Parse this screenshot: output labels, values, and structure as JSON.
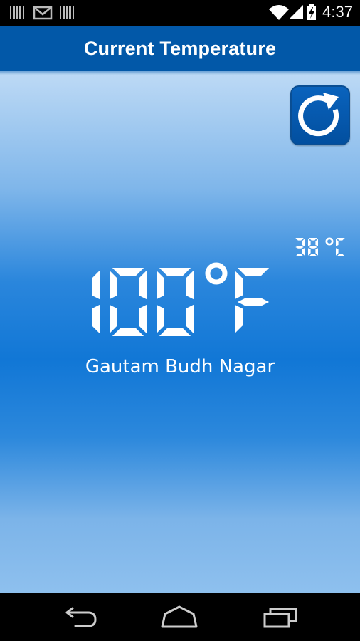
{
  "status_bar": {
    "time": "4:37",
    "icons": [
      "barcode-icon",
      "gmail-icon",
      "barcode-icon",
      "wifi-icon",
      "signal-icon",
      "battery-charging-icon"
    ]
  },
  "action_bar": {
    "title": "Current Temperature",
    "background": "#0258a8"
  },
  "weather": {
    "fahrenheit": "100",
    "fahrenheit_unit": "°F",
    "celsius": "38",
    "celsius_unit": "°C",
    "location": "Gautam Budh Nagar"
  },
  "refresh": {
    "icon": "refresh-icon"
  },
  "nav_bar": {
    "icons": [
      "back-icon",
      "home-icon",
      "recent-apps-icon"
    ]
  },
  "colors": {
    "accent": "#0258a8",
    "digits": "#ffffff"
  }
}
